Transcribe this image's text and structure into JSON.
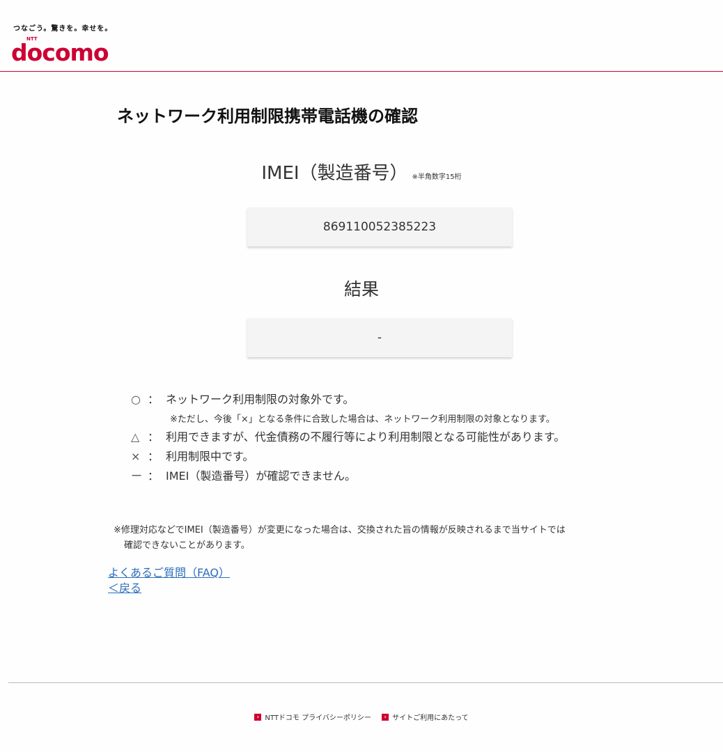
{
  "header": {
    "tagline": "つなごう。驚きを。幸せを。",
    "logo": {
      "brand": "docomo",
      "sub": "NTT"
    }
  },
  "page_title": "ネットワーク利用制限携帯電話機の確認",
  "imei": {
    "label": "IMEI（製造番号）",
    "hint": "※半角数字15桁",
    "value": "869110052385223"
  },
  "result": {
    "label": "結果",
    "value": "-"
  },
  "legend": [
    {
      "symbol": "○",
      "colon": "：",
      "text": "ネットワーク利用制限の対象外です。"
    },
    {
      "symbol": "△",
      "colon": "：",
      "text": "利用できますが、代金債務の不履行等により利用制限となる可能性があります。"
    },
    {
      "symbol": "×",
      "colon": "：",
      "text": "利用制限中です。"
    },
    {
      "symbol": "ー",
      "colon": "：",
      "text": "IMEI（製造番号）が確認できません。"
    }
  ],
  "legend_note": "※ただし、今後「×」となる条件に合致した場合は、ネットワーク利用制限の対象となります。",
  "notice": {
    "line1": "※修理対応などでIMEI（製造番号）が変更になった場合は、交換された旨の情報が反映されるまで当サイトでは",
    "line2": "確認できないことがあります。"
  },
  "links": {
    "faq": "よくあるご質問（FAQ）",
    "back": "＜戻る"
  },
  "footer": {
    "privacy": "NTTドコモ プライバシーポリシー",
    "terms": "サイトご利用にあたって"
  },
  "colors": {
    "brand": "#cc0033",
    "link": "#2a6ebb"
  }
}
